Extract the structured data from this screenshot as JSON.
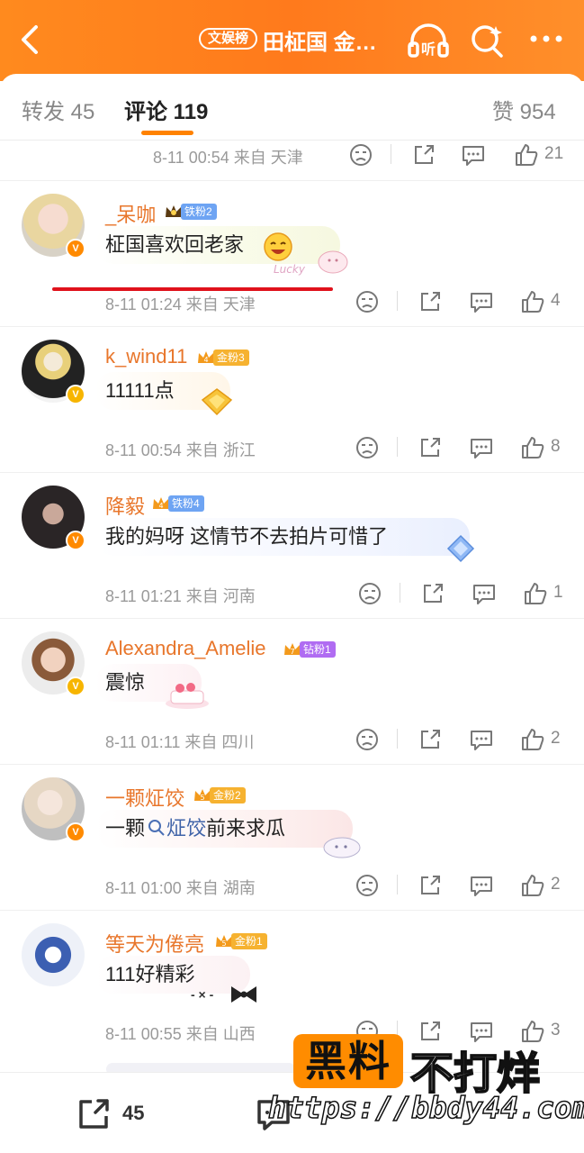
{
  "header": {
    "tag": "文娱榜",
    "title": "田柾国 金…",
    "listen_label": "听"
  },
  "tabs": {
    "repost": "转发 45",
    "comment": "评论 119",
    "like": "赞 954"
  },
  "top_partial": {
    "time": "8-11 00:54 来自 天津",
    "likes": "21"
  },
  "comments": [
    {
      "user": "_呆咖",
      "fan": "铁粉2",
      "fan_level": "",
      "text": "柾国喜欢回老家",
      "time": "8-11 01:24 来自 天津",
      "likes": "4",
      "deco": "Lucky"
    },
    {
      "user": "k_wind11",
      "fan": "金粉3",
      "fan_level": "4",
      "text": "11111点",
      "time": "8-11 00:54 来自 浙江",
      "likes": "8",
      "deco": ""
    },
    {
      "user": "降毅",
      "fan": "铁粉4",
      "fan_level": "4",
      "text": "我的妈呀 这情节不去拍片可惜了",
      "time": "8-11 01:21 来自 河南",
      "likes": "1",
      "deco": ""
    },
    {
      "user": "Alexandra_Amelie",
      "fan": "钻粉1",
      "fan_level": "7",
      "text": "震惊",
      "time": "8-11 01:11 来自 四川",
      "likes": "2",
      "deco": ""
    },
    {
      "user": "一颗炡饺",
      "fan": "金粉2",
      "fan_level": "5",
      "text_prefix": "一颗",
      "text_link": "炡饺",
      "text_suffix": "前来求瓜",
      "time": "8-11 01:00 来自 湖南",
      "likes": "2",
      "deco": ""
    },
    {
      "user": "等天为倦亮",
      "fan": "金粉1",
      "fan_level": "5",
      "text": "111好精彩",
      "time": "8-11 00:55 来自 山西",
      "likes": "3",
      "deco": "- × -"
    }
  ],
  "bottom": {
    "repost_count": "45"
  },
  "watermark": {
    "box": "黑料",
    "text": "不打烊",
    "url": "https://bbdy44.com"
  }
}
